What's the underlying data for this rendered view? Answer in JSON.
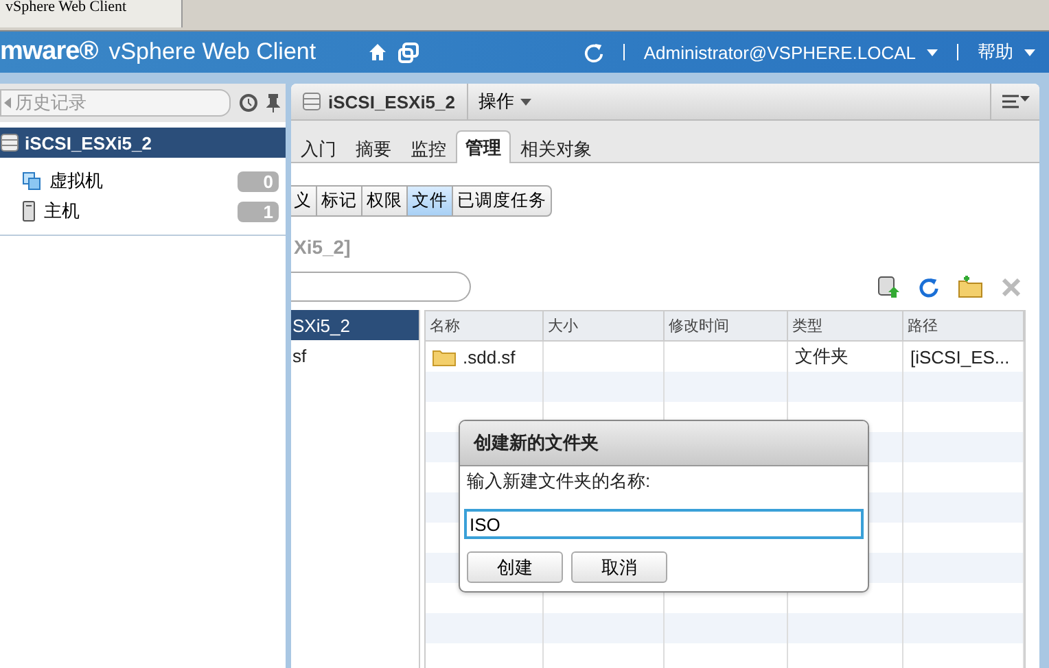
{
  "browser": {
    "title": "vSphere Web Client"
  },
  "header": {
    "logo": "mware®",
    "product": "vSphere Web Client",
    "user": "Administrator@VSPHERE.LOCAL",
    "help": "帮助"
  },
  "sidebar": {
    "history": "历史记录",
    "selected": "iSCSI_ESXi5_2",
    "items": [
      {
        "label": "虚拟机",
        "count": "0",
        "kind": "vm"
      },
      {
        "label": "主机",
        "count": "1",
        "kind": "host"
      }
    ]
  },
  "object": {
    "title": "iSCSI_ESXi5_2",
    "actions": "操作"
  },
  "tabs": [
    {
      "label": "入门",
      "selected": false
    },
    {
      "label": "摘要",
      "selected": false
    },
    {
      "label": "监控",
      "selected": false
    },
    {
      "label": "管理",
      "selected": true
    },
    {
      "label": "相关对象",
      "selected": false
    }
  ],
  "subtabs": [
    {
      "label": "义",
      "selected": false
    },
    {
      "label": "标记",
      "selected": false
    },
    {
      "label": "权限",
      "selected": false
    },
    {
      "label": "文件",
      "selected": true
    },
    {
      "label": "已调度任务",
      "selected": false
    }
  ],
  "section_title": "Xi5_2]",
  "tree": [
    {
      "label": "SXi5_2",
      "selected": true
    },
    {
      "label": "sf",
      "selected": false
    }
  ],
  "table": {
    "columns": [
      "名称",
      "大小",
      "修改时间",
      "类型",
      "路径"
    ],
    "rows": [
      {
        "cells": [
          ".sdd.sf",
          null,
          null,
          "文件夹",
          "[iSCSI_ES..."
        ]
      }
    ]
  },
  "dialog": {
    "title": "创建新的文件夹",
    "label": "输入新建文件夹的名称:",
    "value": "ISO",
    "buttons": [
      "创建",
      "取消"
    ]
  }
}
